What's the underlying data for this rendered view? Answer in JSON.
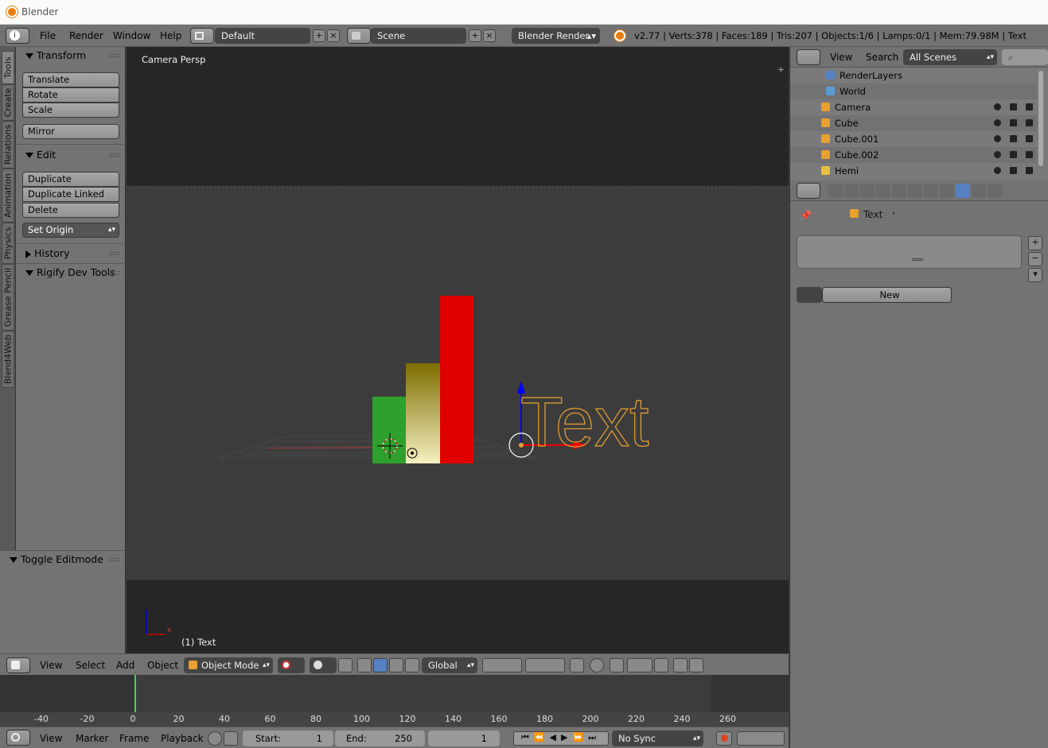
{
  "window": {
    "title": "Blender"
  },
  "topbar": {
    "menus": [
      "File",
      "Render",
      "Window",
      "Help"
    ],
    "screen_layout": "Default",
    "scene": "Scene",
    "render_engine": "Blender Render",
    "stats": "v2.77 | Verts:378 | Faces:189 | Tris:207 | Objects:1/6 | Lamps:0/1 | Mem:79.98M | Text"
  },
  "left_tabs": [
    "Tools",
    "Create",
    "Relations",
    "Animation",
    "Physics",
    "Grease Pencil",
    "Blend4Web"
  ],
  "toolshelf": {
    "transform": {
      "title": "Transform",
      "buttons": [
        "Translate",
        "Rotate",
        "Scale",
        "Mirror"
      ]
    },
    "edit": {
      "title": "Edit",
      "buttons": [
        "Duplicate",
        "Duplicate Linked",
        "Delete"
      ],
      "set_origin": "Set Origin"
    },
    "history": "History",
    "rigify": "Rigify Dev Tools",
    "operator": "Toggle Editmode"
  },
  "viewport": {
    "label": "Camera Persp",
    "object_label": "(1) Text",
    "text_object": "Text"
  },
  "viewport_header": {
    "menus": [
      "View",
      "Select",
      "Add",
      "Object"
    ],
    "mode": "Object Mode",
    "orientation": "Global"
  },
  "timeline": {
    "ticks": [
      "-40",
      "-20",
      "0",
      "20",
      "40",
      "60",
      "80",
      "100",
      "120",
      "140",
      "160",
      "180",
      "200",
      "220",
      "240",
      "260"
    ],
    "current_frame_value": 0
  },
  "timeline_header": {
    "menus": [
      "View",
      "Marker",
      "Frame",
      "Playback"
    ],
    "start_label": "Start:",
    "start": "1",
    "end_label": "End:",
    "end": "250",
    "current": "1",
    "sync": "No Sync"
  },
  "outliner": {
    "view": "View",
    "search": "Search",
    "filter": "All Scenes",
    "items": [
      "RenderLayers",
      "World",
      "Camera",
      "Cube",
      "Cube.001",
      "Cube.002",
      "Hemi"
    ]
  },
  "properties": {
    "breadcrumb": "Text",
    "new_button": "New"
  },
  "colors": {
    "bar_green": "#2ea02e",
    "bar_yellow": "#8a7a10",
    "bar_red": "#e00000",
    "text_outline": "#e8a030",
    "accent": "#5680c2"
  }
}
